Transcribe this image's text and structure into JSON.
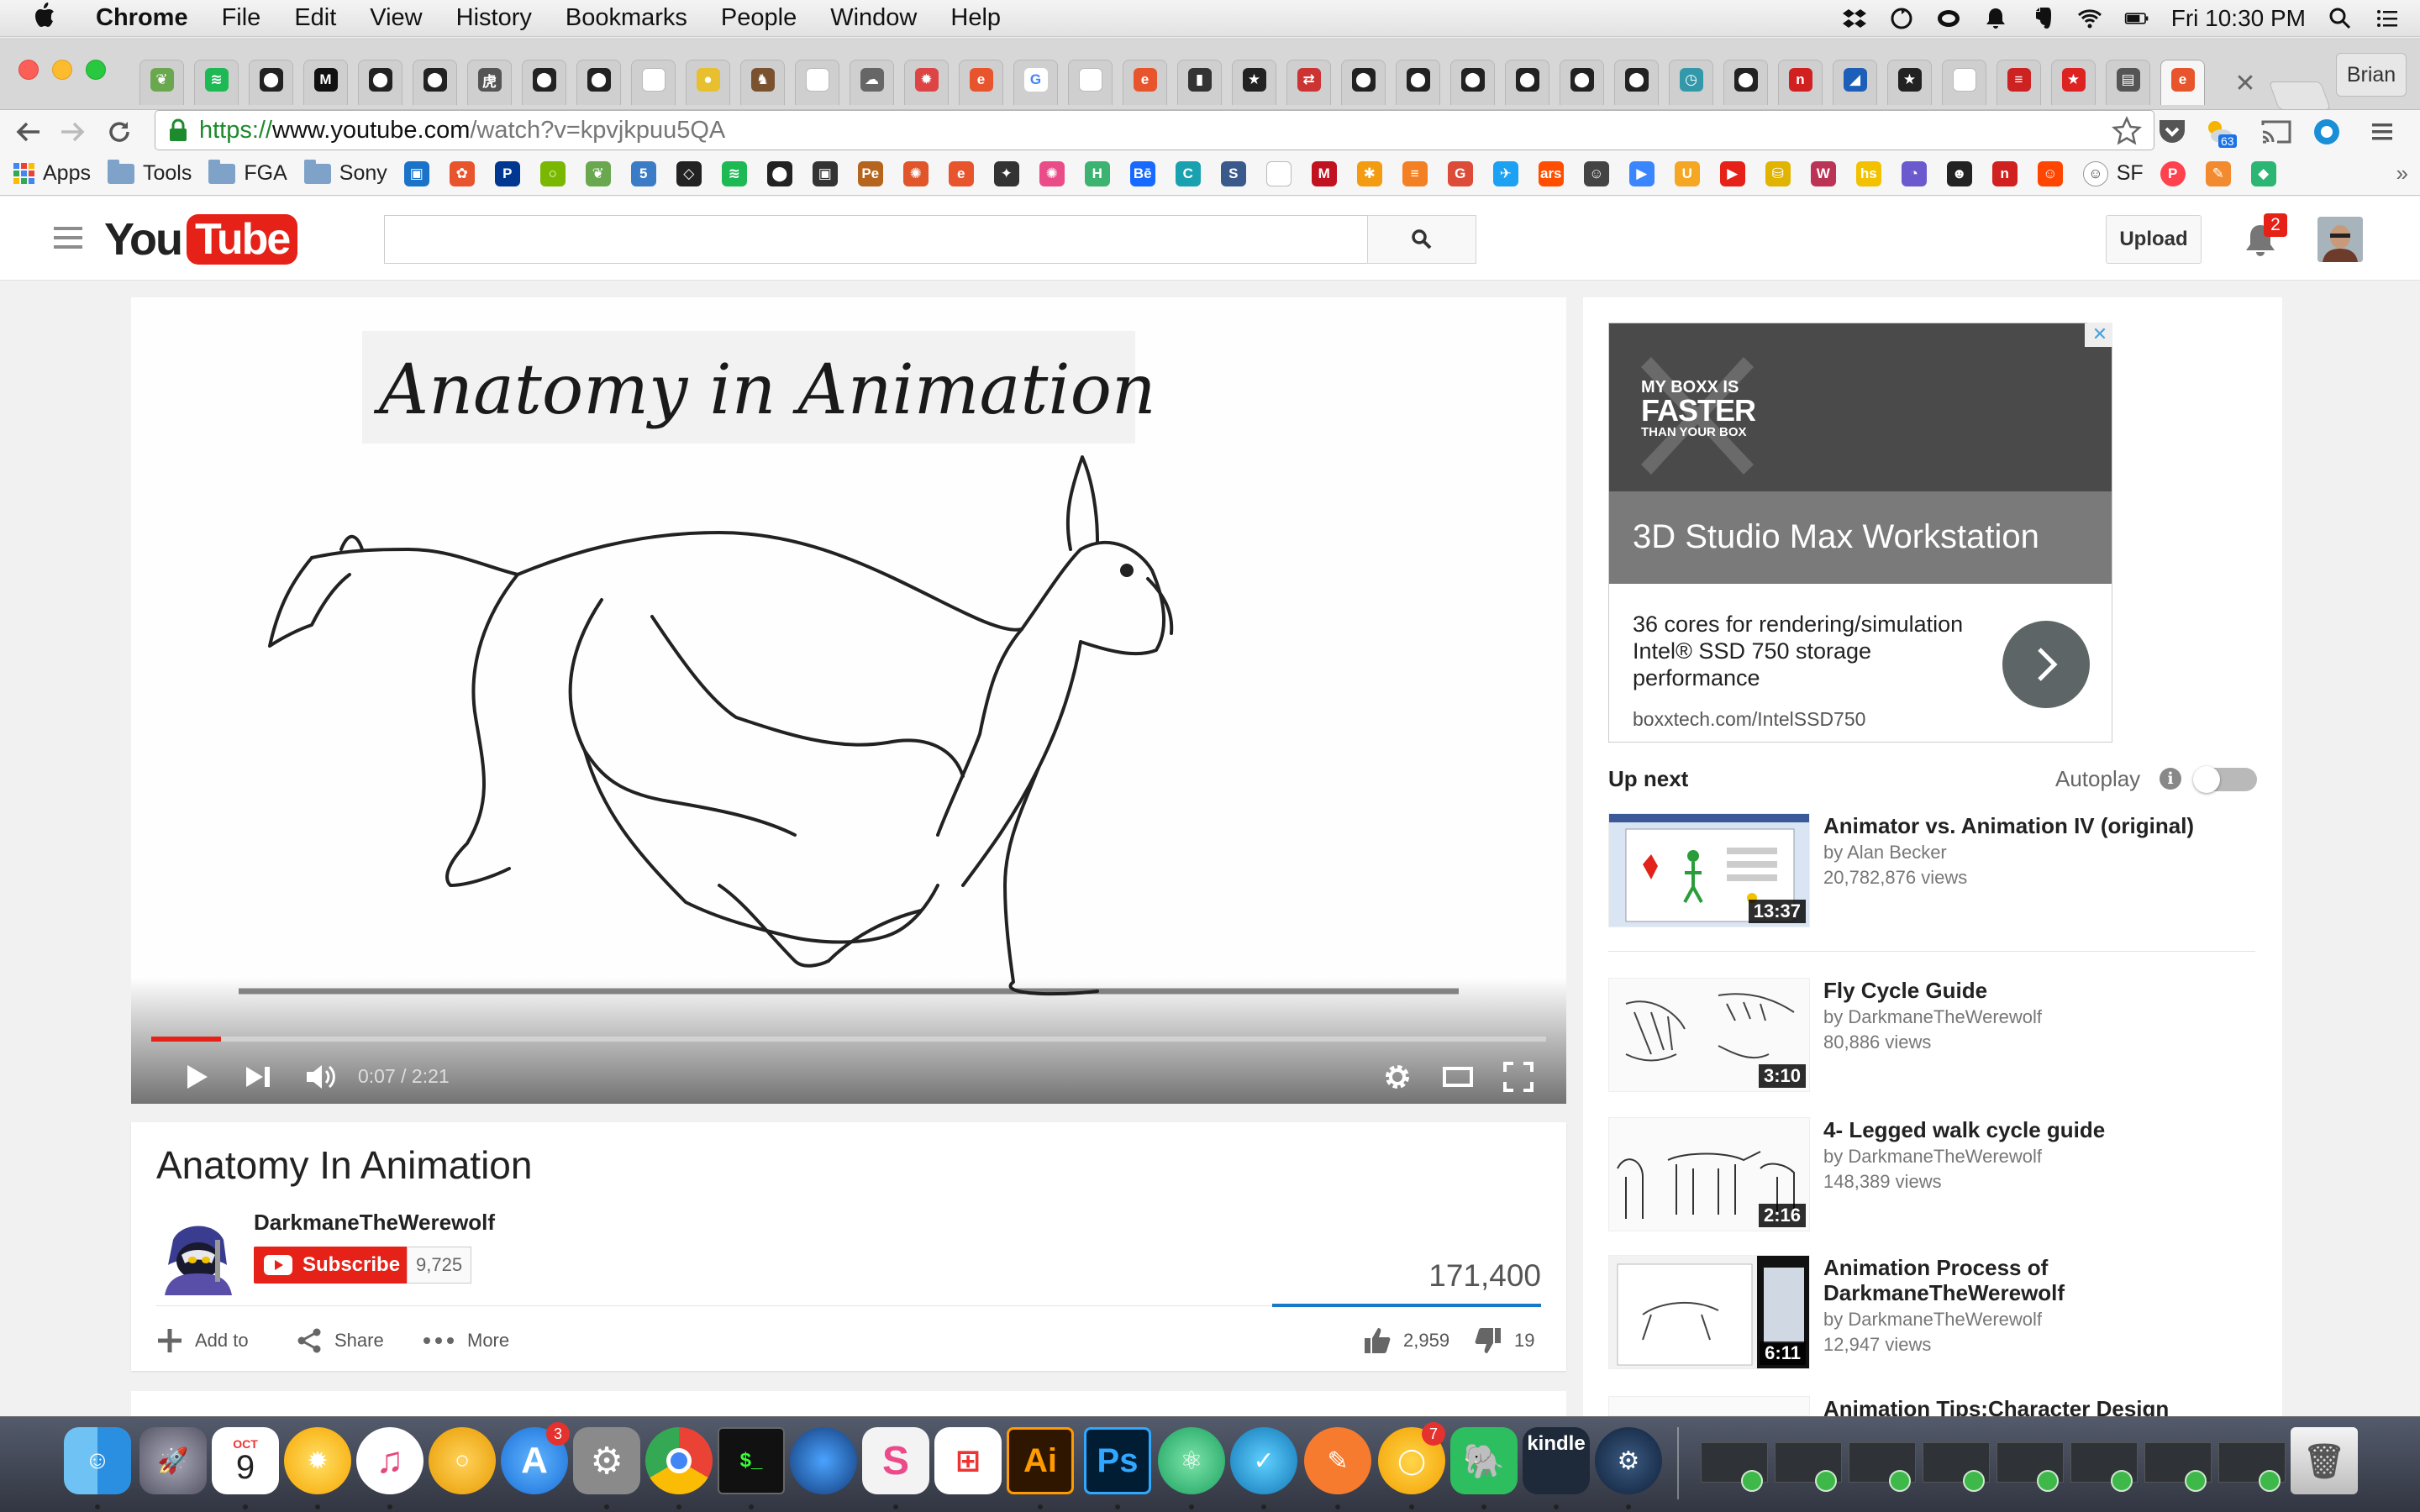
{
  "menubar": {
    "app": "Chrome",
    "items": [
      "File",
      "Edit",
      "View",
      "History",
      "Bookmarks",
      "People",
      "Window",
      "Help"
    ],
    "clock": "Fri 10:30 PM"
  },
  "browser": {
    "profile": "Brian",
    "url_scheme": "https://",
    "url_host": "www.youtube.com",
    "url_path": "/watch?v=kpvjkpuu5QA",
    "weather_badge": "63",
    "tabs": [
      {
        "icon": "leaf",
        "color": "#6aa84f"
      },
      {
        "icon": "spotify",
        "color": "#1db954"
      },
      {
        "icon": "github",
        "color": "#222"
      },
      {
        "icon": "medium",
        "color": "#111"
      },
      {
        "icon": "github",
        "color": "#222"
      },
      {
        "icon": "github",
        "color": "#222"
      },
      {
        "icon": "kanji",
        "color": "#555"
      },
      {
        "icon": "github",
        "color": "#222"
      },
      {
        "icon": "github",
        "color": "#222"
      },
      {
        "icon": "page",
        "color": "#ddd"
      },
      {
        "icon": "circle",
        "color": "#e8c02f"
      },
      {
        "icon": "horse",
        "color": "#7a5230"
      },
      {
        "icon": "page",
        "color": "#ddd"
      },
      {
        "icon": "cloud",
        "color": "#666"
      },
      {
        "icon": "gear",
        "color": "#d44"
      },
      {
        "icon": "e",
        "color": "#e8552d"
      },
      {
        "icon": "google",
        "color": "#4285f4"
      },
      {
        "icon": "page",
        "color": "#ddd"
      },
      {
        "icon": "e",
        "color": "#e8552d"
      },
      {
        "icon": "film",
        "color": "#333"
      },
      {
        "icon": "star",
        "color": "#222"
      },
      {
        "icon": "arrows",
        "color": "#c33"
      },
      {
        "icon": "github",
        "color": "#222"
      },
      {
        "icon": "github",
        "color": "#222"
      },
      {
        "icon": "github",
        "color": "#222"
      },
      {
        "icon": "github",
        "color": "#222"
      },
      {
        "icon": "github",
        "color": "#222"
      },
      {
        "icon": "github",
        "color": "#222"
      },
      {
        "icon": "clock",
        "color": "#39a"
      },
      {
        "icon": "github",
        "color": "#222"
      },
      {
        "icon": "n",
        "color": "#d02020"
      },
      {
        "icon": "chart",
        "color": "#1d5fb8"
      },
      {
        "icon": "star",
        "color": "#222"
      },
      {
        "icon": "page",
        "color": "#ddd"
      },
      {
        "icon": "stack",
        "color": "#c22"
      },
      {
        "icon": "star-red",
        "color": "#d22"
      },
      {
        "icon": "doc",
        "color": "#555"
      },
      {
        "icon": "e",
        "color": "#e8552d"
      }
    ],
    "bookmarks": {
      "apps": "Apps",
      "folders": [
        "Tools",
        "FGA",
        "Sony"
      ],
      "icons": [
        {
          "icon": "bm-1",
          "color": "#1a73c8"
        },
        {
          "icon": "bm-2",
          "color": "#e8552d"
        },
        {
          "icon": "playstation",
          "color": "#003791"
        },
        {
          "icon": "circle-outline",
          "color": "#7ab800"
        },
        {
          "icon": "leaf",
          "color": "#6aa84f"
        },
        {
          "icon": "html5",
          "color": "#3c7cc6"
        },
        {
          "icon": "codepen",
          "color": "#222"
        },
        {
          "icon": "spotify",
          "color": "#1db954"
        },
        {
          "icon": "github",
          "color": "#222"
        },
        {
          "icon": "github-square",
          "color": "#333"
        },
        {
          "icon": "pe",
          "color": "#b5651d"
        },
        {
          "icon": "dribbble-like",
          "color": "#e0552a"
        },
        {
          "icon": "e",
          "color": "#e8552d"
        },
        {
          "icon": "puzzle",
          "color": "#333"
        },
        {
          "icon": "dribbble",
          "color": "#ea4c89"
        },
        {
          "icon": "h",
          "color": "#3cb371"
        },
        {
          "icon": "behance",
          "color": "#1769ff"
        },
        {
          "icon": "c",
          "color": "#1aa1b0"
        },
        {
          "icon": "s",
          "color": "#3a5a8c"
        },
        {
          "icon": "page",
          "color": "#ddd"
        },
        {
          "icon": "m",
          "color": "#c0121f"
        },
        {
          "icon": "asterisk",
          "color": "#f39c12"
        },
        {
          "icon": "stack",
          "color": "#f48024"
        },
        {
          "icon": "g-plus",
          "color": "#dd4b39"
        },
        {
          "icon": "twitter",
          "color": "#1da1f2"
        },
        {
          "icon": "ars",
          "color": "#ff4e00"
        },
        {
          "icon": "person",
          "color": "#444"
        },
        {
          "icon": "play",
          "color": "#3a86ff"
        },
        {
          "icon": "u",
          "color": "#f5a623"
        },
        {
          "icon": "yt-play",
          "color": "#e62117"
        },
        {
          "icon": "db",
          "color": "#e0b400"
        },
        {
          "icon": "w",
          "color": "#b35"
        },
        {
          "icon": "hs",
          "color": "#f2c200"
        },
        {
          "icon": "pie",
          "color": "#6a5acd"
        },
        {
          "icon": "ninja",
          "color": "#222"
        },
        {
          "icon": "n",
          "color": "#d02020"
        },
        {
          "icon": "reddit",
          "color": "#ff4500"
        }
      ],
      "sf": "SF"
    }
  },
  "youtube": {
    "logo_you": "You",
    "logo_tube": "Tube",
    "search_placeholder": "",
    "upload": "Upload",
    "notifications": "2"
  },
  "video": {
    "frame_text": "Anatomy in Animation",
    "time": "0:07 / 2:21",
    "progress": 0.05,
    "title": "Anatomy In Animation",
    "channel": "DarkmaneTheWerewolf",
    "subscribe": "Subscribe",
    "subscribers": "9,725",
    "views": "171,400",
    "actions": {
      "add_to": "Add to",
      "share": "Share",
      "more": "More"
    },
    "likes": "2,959",
    "dislikes": "19"
  },
  "ad": {
    "logo_line1": "MY BOXX IS",
    "logo_line2": "FASTER",
    "logo_line3": "THAN YOUR BOX",
    "headline": "3D Studio Max Workstation",
    "description": "36 cores for rendering/simulation Intel® SSD 750 storage performance",
    "url": "boxxtech.com/IntelSSD750"
  },
  "sidebar": {
    "up_next": "Up next",
    "autoplay": "Autoplay",
    "recommendations": [
      {
        "title": "Animator vs. Animation IV (original)",
        "channel": "by Alan Becker",
        "views": "20,782,876 views",
        "duration": "13:37"
      },
      {
        "title": "Fly Cycle Guide",
        "channel": "by DarkmaneTheWerewolf",
        "views": "80,886 views",
        "duration": "3:10"
      },
      {
        "title": "4- Legged walk cycle guide",
        "channel": "by DarkmaneTheWerewolf",
        "views": "148,389 views",
        "duration": "2:16"
      },
      {
        "title": "Animation Process of DarkmaneTheWerewolf",
        "channel": "by DarkmaneTheWerewolf",
        "views": "12,947 views",
        "duration": "6:11"
      },
      {
        "title": "Animation Tips:Character Design",
        "channel": "",
        "views": "",
        "duration": ""
      }
    ]
  },
  "dock": {
    "calendar_month": "OCT",
    "calendar_day": "9",
    "appstore_badge": "3",
    "spark_badge": "7",
    "ai": "Ai",
    "ps": "Ps",
    "kindle": "kindle"
  }
}
